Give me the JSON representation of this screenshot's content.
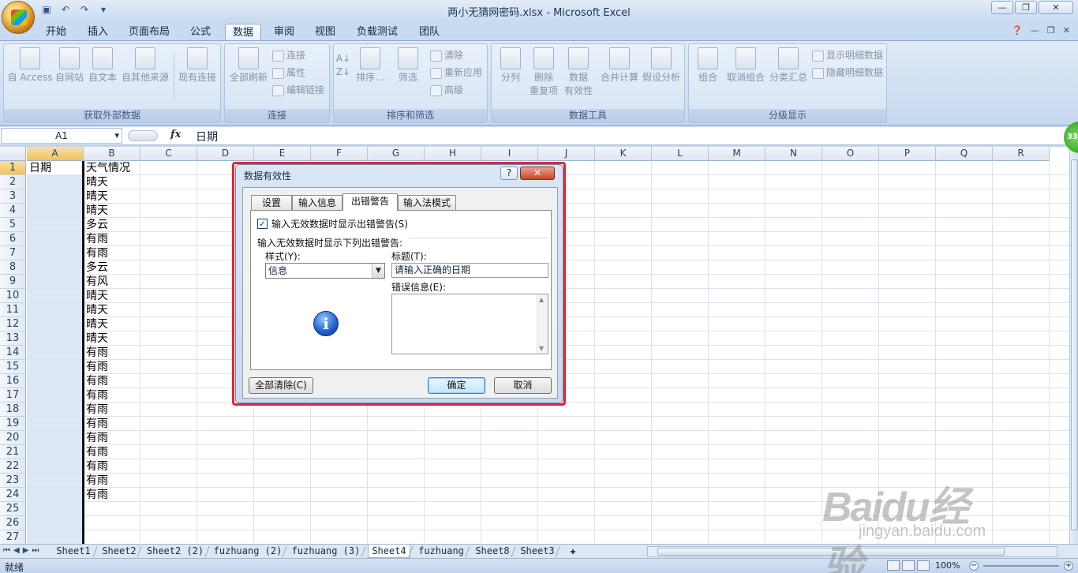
{
  "window": {
    "title": "两小无猜网密码.xlsx - Microsoft Excel",
    "controls": [
      "—",
      "❐",
      "✕"
    ]
  },
  "ribbon_tabs": [
    {
      "label": "开始",
      "active": false
    },
    {
      "label": "插入",
      "active": false
    },
    {
      "label": "页面布局",
      "active": false
    },
    {
      "label": "公式",
      "active": false
    },
    {
      "label": "数据",
      "active": true
    },
    {
      "label": "审阅",
      "active": false
    },
    {
      "label": "视图",
      "active": false
    },
    {
      "label": "负载测试",
      "active": false
    },
    {
      "label": "团队",
      "active": false
    }
  ],
  "ribbon": {
    "external_data": {
      "label": "获取外部数据",
      "buttons": [
        "自 Access",
        "自网站",
        "自文本",
        "自其他来源",
        "现有连接"
      ]
    },
    "connections": {
      "label": "连接",
      "refresh_all": "全部刷新",
      "small": [
        "连接",
        "属性",
        "编辑链接"
      ]
    },
    "sort_filter": {
      "label": "排序和筛选",
      "sort": "排序...",
      "filter": "筛选",
      "small": [
        "清除",
        "重新应用",
        "高级"
      ]
    },
    "data_tools": {
      "label": "数据工具",
      "buttons": [
        "分列",
        "删除\n重复项",
        "数据\n有效性",
        "合并计算",
        "假设分析"
      ]
    },
    "outline": {
      "label": "分级显示",
      "buttons": [
        "组合",
        "取消组合",
        "分类汇总"
      ],
      "small": [
        "显示明细数据",
        "隐藏明细数据"
      ]
    }
  },
  "formula_bar": {
    "name_box": "A1",
    "fx": "fx",
    "value": "日期"
  },
  "side_badge": "33",
  "columns": [
    "A",
    "B",
    "C",
    "D",
    "E",
    "F",
    "G",
    "H",
    "I",
    "J",
    "K",
    "L",
    "M",
    "N",
    "O",
    "P",
    "Q",
    "R"
  ],
  "rows": [
    "1",
    "2",
    "3",
    "4",
    "5",
    "6",
    "7",
    "8",
    "9",
    "10",
    "11",
    "12",
    "13",
    "14",
    "15",
    "16",
    "17",
    "18",
    "19",
    "20",
    "21",
    "22",
    "23",
    "24",
    "25",
    "26",
    "27"
  ],
  "cells": {
    "A1": "日期",
    "B": [
      "天气情况",
      "晴天",
      "晴天",
      "晴天",
      "多云",
      "有雨",
      "有雨",
      "多云",
      "有风",
      "晴天",
      "晴天",
      "晴天",
      "晴天",
      "有雨",
      "有雨",
      "有雨",
      "有雨",
      "有雨",
      "有雨",
      "有雨",
      "有雨",
      "有雨",
      "有雨",
      "有雨"
    ]
  },
  "sheet_tabs": [
    {
      "label": "Sheet1",
      "active": false
    },
    {
      "label": "Sheet2",
      "active": false
    },
    {
      "label": "Sheet2 (2)",
      "active": false
    },
    {
      "label": "fuzhuang (2)",
      "active": false
    },
    {
      "label": "fuzhuang (3)",
      "active": false
    },
    {
      "label": "Sheet4",
      "active": true
    },
    {
      "label": "fuzhuang",
      "active": false
    },
    {
      "label": "Sheet8",
      "active": false
    },
    {
      "label": "Sheet3",
      "active": false
    }
  ],
  "status": {
    "ready": "就绪",
    "zoom": "100%"
  },
  "watermark": {
    "main": "Baidu经验",
    "sub": "jingyan.baidu.com"
  },
  "dialog": {
    "title": "数据有效性",
    "help": "?",
    "close": "✕",
    "tabs": [
      {
        "label": "设置",
        "active": false
      },
      {
        "label": "输入信息",
        "active": false
      },
      {
        "label": "出错警告",
        "active": true
      },
      {
        "label": "输入法模式",
        "active": false
      }
    ],
    "show_alert_checkbox": {
      "label": "输入无效数据时显示出错警告(S)",
      "checked": true
    },
    "section_label": "输入无效数据时显示下列出错警告:",
    "style_label": "样式(Y):",
    "style_value": "信息",
    "title_label": "标题(T):",
    "title_value": "请输入正确的日期",
    "error_label": "错误信息(E):",
    "error_value": "",
    "clear_all": "全部清除(C)",
    "ok": "确定",
    "cancel": "取消"
  }
}
